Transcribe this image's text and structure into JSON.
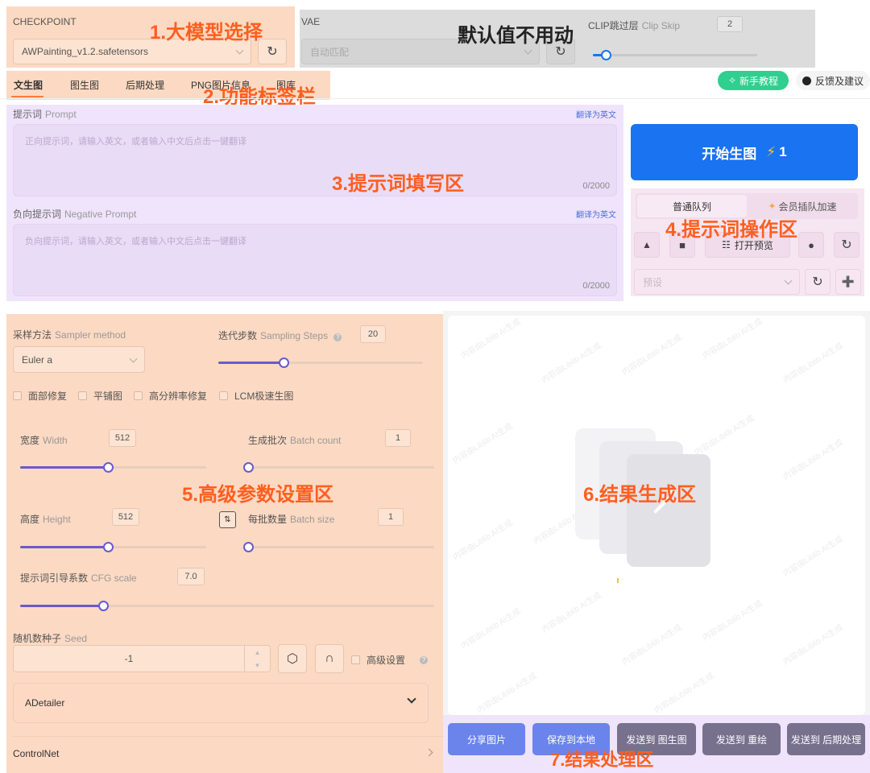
{
  "checkpoint": {
    "label": "CHECKPOINT",
    "value": "AWPainting_v1.2.safetensors"
  },
  "vae": {
    "label": "VAE",
    "value": "自动匹配"
  },
  "clip_skip": {
    "label": "CLIP跳过层",
    "label_en": "Clip Skip",
    "value": "2",
    "level": 0.08
  },
  "tabs": [
    "文生图",
    "图生图",
    "后期处理",
    "PNG图片信息",
    "图库"
  ],
  "header_buttons": {
    "tutorial": "新手教程",
    "feedback": "反馈及建议"
  },
  "prompt": {
    "label": "提示词",
    "label_en": "Prompt",
    "translate": "翻译为英文",
    "placeholder": "正向提示词，请输入英文，或者输入中文后点击一键翻译",
    "counter": "0/2000"
  },
  "negative_prompt": {
    "label": "负向提示词",
    "label_en": "Negative Prompt",
    "translate": "翻译为英文",
    "placeholder": "负向提示词，请输入英文，或者输入中文后点击一键翻译",
    "counter": "0/2000"
  },
  "generate": {
    "label": "开始生图",
    "cost": "1"
  },
  "queue_tabs": {
    "normal": "普通队列",
    "vip": "会员插队加速"
  },
  "preview_button": "打开预览",
  "preset_placeholder": "预设",
  "sampler": {
    "label": "采样方法",
    "label_en": "Sampler method",
    "value": "Euler a"
  },
  "steps": {
    "label": "迭代步数",
    "label_en": "Sampling Steps",
    "value": "20",
    "level": 0.32
  },
  "checkboxes": [
    "面部修复",
    "平铺图",
    "高分辨率修复",
    "LCM极速生图"
  ],
  "width": {
    "label": "宽度",
    "label_en": "Width",
    "value": "512",
    "level": 0.47
  },
  "batch_count": {
    "label": "生成批次",
    "label_en": "Batch count",
    "value": "1",
    "level": 0.0
  },
  "height": {
    "label": "高度",
    "label_en": "Height",
    "value": "512",
    "level": 0.47
  },
  "batch_size": {
    "label": "每批数量",
    "label_en": "Batch size",
    "value": "1",
    "level": 0.0
  },
  "swap_icon_text": "⇅",
  "cfg": {
    "label": "提示词引导系数",
    "label_en": "CFG scale",
    "value": "7.0",
    "level": 0.2
  },
  "seed": {
    "label": "随机数种子",
    "label_en": "Seed",
    "value": "-1"
  },
  "advanced_label": "高级设置",
  "adetailer": "ADetailer",
  "controlnet": "ControlNet",
  "watermark": "内容由Liblib AI生成",
  "result_buttons": [
    "分享图片",
    "保存到本地",
    "发送到 图生图",
    "发送到 重绘",
    "发送到 后期处理"
  ],
  "annotations": {
    "a1": "1.大模型选择",
    "a_default": "默认值不用动",
    "a2": "2.功能标签栏",
    "a3": "3.提示词填写区",
    "a4": "4.提示词操作区",
    "a5": "5.高级参数设置区",
    "a6": "6.结果生成区",
    "a7": "7.结果处理区"
  },
  "colors": {
    "orange_zone": "#fcd9c2",
    "purple_zone": "#efe4fb",
    "gray_zone": "#dcdcdc",
    "primary_blue": "#1a73f0",
    "tutorial_green": "#2fcf8f",
    "slider_accent": "#6a5acd",
    "annotation_orange": "#ff5e1f"
  }
}
